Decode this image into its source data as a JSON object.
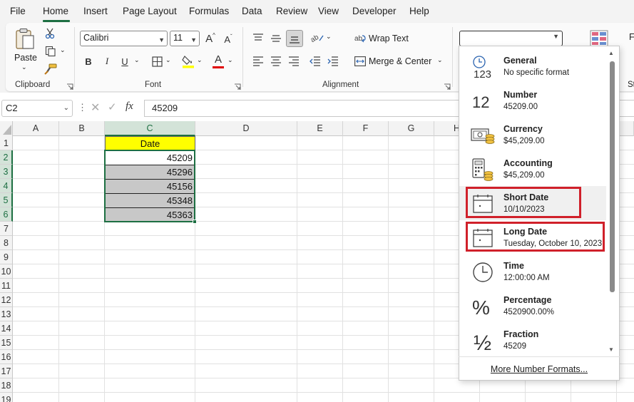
{
  "menu": {
    "file": "File",
    "home": "Home",
    "insert": "Insert",
    "page_layout": "Page Layout",
    "formulas": "Formulas",
    "data": "Data",
    "review": "Review",
    "view": "View",
    "developer": "Developer",
    "help": "Help"
  },
  "ribbon": {
    "clipboard": {
      "paste_label": "Paste",
      "group_label": "Clipboard"
    },
    "font": {
      "font_name": "Calibri",
      "font_size": "11",
      "group_label": "Font",
      "bold": "B",
      "italic": "I",
      "underline": "U",
      "font_color": "#e00000",
      "fill_color": "#ffff00"
    },
    "alignment": {
      "wrap_text": "Wrap Text",
      "merge_center": "Merge & Center",
      "group_label": "Alignment"
    },
    "number": {
      "format_value": "",
      "group_label_partial": ""
    },
    "right_partial": "St"
  },
  "formula_bar": {
    "name_box": "C2",
    "fx_label": "fx",
    "value": "45209"
  },
  "grid": {
    "columns": [
      "A",
      "B",
      "C",
      "D",
      "E",
      "F",
      "G",
      "H"
    ],
    "rows": [
      "1",
      "2",
      "3",
      "4",
      "5",
      "6",
      "7",
      "8",
      "9",
      "10",
      "11",
      "12",
      "13",
      "14",
      "15",
      "16",
      "17",
      "18",
      "19"
    ],
    "header_cell": "Date",
    "values": [
      "45209",
      "45296",
      "45156",
      "45348",
      "45363"
    ]
  },
  "number_format": {
    "items": [
      {
        "name": "General",
        "sample": "No specific format",
        "icon": "clock-123-icon"
      },
      {
        "name": "Number",
        "sample": "45209.00",
        "icon": "number-12-icon"
      },
      {
        "name": "Currency",
        "sample": "$45,209.00",
        "icon": "currency-icon"
      },
      {
        "name": "Accounting",
        "sample": " $45,209.00",
        "icon": "accounting-calculator-icon"
      },
      {
        "name": "Short Date",
        "sample": "10/10/2023",
        "icon": "calendar-icon"
      },
      {
        "name": "Long Date",
        "sample": "Tuesday, October 10, 2023",
        "icon": "calendar-icon"
      },
      {
        "name": "Time",
        "sample": "12:00:00 AM",
        "icon": "clock-icon"
      },
      {
        "name": "Percentage",
        "sample": "4520900.00%",
        "icon": "percent-icon"
      },
      {
        "name": "Fraction",
        "sample": "45209",
        "icon": "fraction-icon"
      }
    ],
    "number_glyph": "12",
    "percent_glyph": "%",
    "fraction_glyph": "½",
    "general_digits": "123",
    "more": "More Number Formats...",
    "highlight_color": "#d0202a"
  },
  "colors": {
    "accent": "#1d6f42",
    "header_fill": "#ffff00",
    "data_fill": "#c8c8c8"
  }
}
